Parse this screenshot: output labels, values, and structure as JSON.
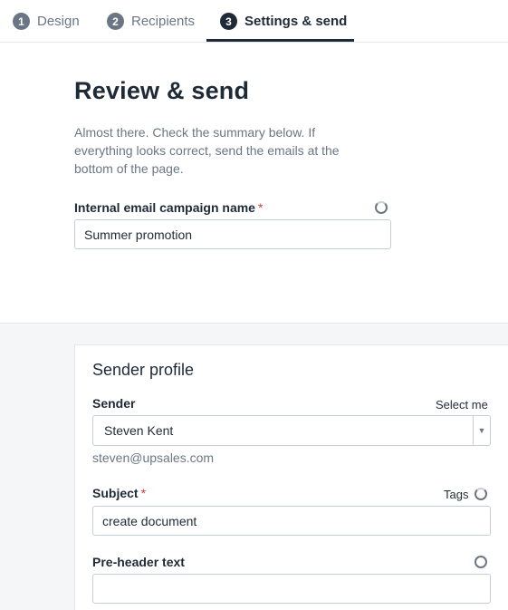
{
  "tabs": [
    {
      "num": "1",
      "label": "Design"
    },
    {
      "num": "2",
      "label": "Recipients"
    },
    {
      "num": "3",
      "label": "Settings & send",
      "active": true
    }
  ],
  "review": {
    "title": "Review & send",
    "intro": "Almost there. Check the summary below. If everything looks correct, send the emails at the bottom of the page.",
    "campaign_label": "Internal email campaign name",
    "required_mark": "*",
    "campaign_value": "Summer promotion"
  },
  "sender_profile": {
    "title": "Sender profile",
    "sender_label": "Sender",
    "select_me": "Select me",
    "sender_value": "Steven Kent",
    "sender_email": "steven@upsales.com",
    "subject_label": "Subject",
    "tags_label": "Tags",
    "subject_value": "create document",
    "preheader_label": "Pre-header text",
    "preheader_value": ""
  },
  "icons": {
    "loading": "spinner-icon",
    "dropdown": "caret-down-icon"
  },
  "colors": {
    "active_tab": "#1f2a37",
    "inactive_tab": "#6b7684",
    "required": "#d33a3a",
    "section_bg": "#f4f6f8"
  }
}
